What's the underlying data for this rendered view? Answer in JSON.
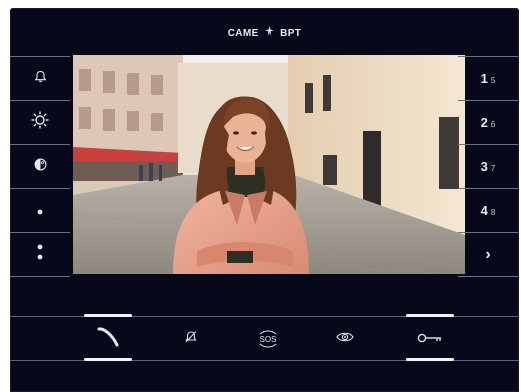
{
  "brand": {
    "left": "CAME",
    "right": "BPT",
    "logo_icon": "came-star-icon"
  },
  "left_column": [
    {
      "id": "bell",
      "icon": "bell-icon"
    },
    {
      "id": "brightness",
      "icon": "brightness-icon"
    },
    {
      "id": "color",
      "icon": "color-palette-icon"
    },
    {
      "id": "dot-one",
      "icon": "single-dot-icon"
    },
    {
      "id": "dot-two",
      "icon": "two-dots-icon"
    }
  ],
  "right_column": [
    {
      "id": "door-1",
      "label": "1",
      "sub": "5"
    },
    {
      "id": "door-2",
      "label": "2",
      "sub": "6"
    },
    {
      "id": "door-3",
      "label": "3",
      "sub": "7"
    },
    {
      "id": "door-4",
      "label": "4",
      "sub": "8"
    },
    {
      "id": "next",
      "label": "›",
      "icon": "chevron-right-icon"
    }
  ],
  "bottom_bar": [
    {
      "id": "answer",
      "icon": "handset-icon"
    },
    {
      "id": "mute",
      "icon": "bell-off-icon"
    },
    {
      "id": "sos",
      "label": "SOS",
      "icon": "sos-icon"
    },
    {
      "id": "view",
      "icon": "eye-icon"
    },
    {
      "id": "door-open",
      "icon": "key-icon"
    }
  ],
  "video_feed": {
    "description_icon": "camera-feed-icon"
  },
  "colors": {
    "device": "#07091a",
    "accent": "#f4f5fa",
    "divider": "#6a6f86"
  }
}
